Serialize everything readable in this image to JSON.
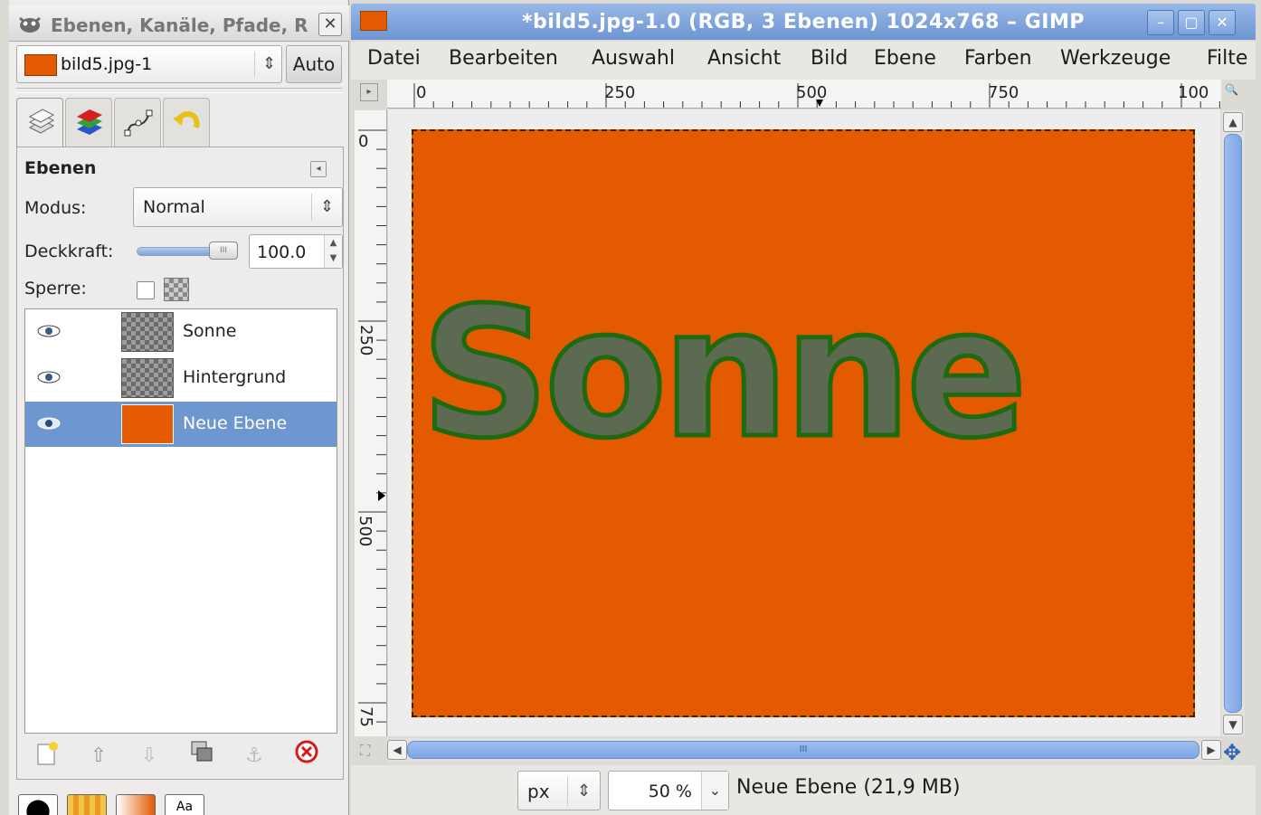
{
  "dock": {
    "title": "Ebenen, Kanäle, Pfade, R",
    "image_selector": "bild5.jpg-1",
    "auto_label": "Auto",
    "tabs": [
      {
        "name": "layers-tab",
        "icon": "layers-icon"
      },
      {
        "name": "channels-tab",
        "icon": "channels-icon"
      },
      {
        "name": "paths-tab",
        "icon": "paths-icon"
      },
      {
        "name": "undo-history-tab",
        "icon": "undo-icon"
      }
    ],
    "panel_title": "Ebenen",
    "mode_label": "Modus:",
    "mode_value": "Normal",
    "opacity_label": "Deckkraft:",
    "opacity_value": "100.0",
    "opacity_fraction": 1.0,
    "lock_label": "Sperre:",
    "layers": [
      {
        "name": "Sonne",
        "visible": true,
        "thumb": "checker",
        "selected": false
      },
      {
        "name": "Hintergrund",
        "visible": true,
        "thumb": "checker",
        "selected": false
      },
      {
        "name": "Neue Ebene",
        "visible": true,
        "thumb": "orange",
        "selected": true
      }
    ],
    "layer_buttons": [
      "new-layer",
      "raise-layer",
      "lower-layer",
      "duplicate-layer",
      "anchor-layer",
      "delete-layer"
    ]
  },
  "window": {
    "title": "*bild5.jpg-1.0 (RGB, 3 Ebenen) 1024x768 – GIMP",
    "menus": [
      "Datei",
      "Bearbeiten",
      "Auswahl",
      "Ansicht",
      "Bild",
      "Ebene",
      "Farben",
      "Werkzeuge",
      "Filte"
    ],
    "ruler_h_labels": [
      "0",
      "250",
      "500",
      "750",
      "100"
    ],
    "ruler_v_labels": [
      "0",
      "250",
      "500",
      "75"
    ],
    "canvas_text": "Sonne",
    "unit": "px",
    "zoom": "50 %",
    "status": "Neue Ebene (21,9 MB)"
  },
  "colors": {
    "accent_orange": "#e35a00",
    "selection_blue": "#6f97cf",
    "titlebar_blue": "#7ea4dc",
    "text_outline_green": "#1d6a10"
  }
}
